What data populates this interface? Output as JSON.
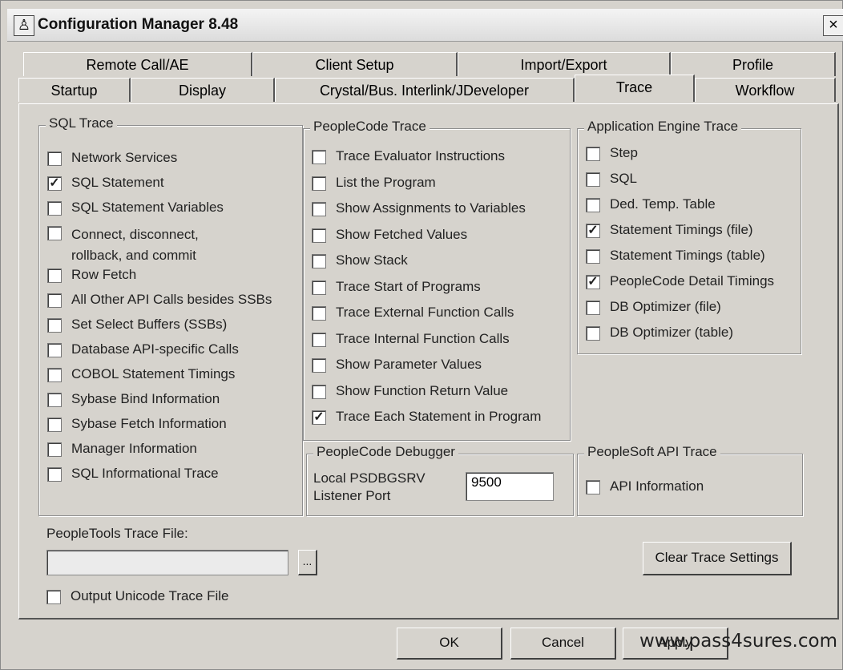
{
  "window": {
    "title": "Configuration Manager 8.48",
    "close_glyph": "×",
    "icon": "app-icon"
  },
  "tabs_row1": [
    "Remote Call/AE",
    "Client Setup",
    "Import/Export",
    "Profile"
  ],
  "tabs_row2": [
    "Startup",
    "Display",
    "Crystal/Bus. Interlink/JDeveloper",
    "Trace",
    "Workflow"
  ],
  "active_tab": "Trace",
  "sql_trace": {
    "title": "SQL Trace",
    "items": [
      {
        "label": "Network Services",
        "checked": false
      },
      {
        "label": "SQL Statement",
        "checked": true
      },
      {
        "label": "SQL Statement Variables",
        "checked": false
      },
      {
        "label": "Connect, disconnect, rollback, and commit",
        "checked": false
      },
      {
        "label": "Row Fetch",
        "checked": false
      },
      {
        "label": "All Other API Calls besides SSBs",
        "checked": false
      },
      {
        "label": "Set Select Buffers (SSBs)",
        "checked": false
      },
      {
        "label": "Database API-specific Calls",
        "checked": false
      },
      {
        "label": "COBOL Statement Timings",
        "checked": false
      },
      {
        "label": "Sybase Bind Information",
        "checked": false
      },
      {
        "label": "Sybase Fetch Information",
        "checked": false
      },
      {
        "label": "Manager Information",
        "checked": false
      },
      {
        "label": "SQL Informational Trace",
        "checked": false
      }
    ]
  },
  "peoplecode_trace": {
    "title": "PeopleCode Trace",
    "items": [
      {
        "label": "Trace Evaluator Instructions",
        "checked": false
      },
      {
        "label": "List the Program",
        "checked": false
      },
      {
        "label": "Show Assignments to Variables",
        "checked": false
      },
      {
        "label": "Show Fetched Values",
        "checked": false
      },
      {
        "label": "Show Stack",
        "checked": false
      },
      {
        "label": "Trace Start of Programs",
        "checked": false
      },
      {
        "label": "Trace External Function Calls",
        "checked": false
      },
      {
        "label": "Trace Internal Function Calls",
        "checked": false
      },
      {
        "label": "Show Parameter Values",
        "checked": false
      },
      {
        "label": "Show Function Return Value",
        "checked": false
      },
      {
        "label": "Trace Each Statement in Program",
        "checked": true
      }
    ]
  },
  "app_engine_trace": {
    "title": "Application Engine Trace",
    "items": [
      {
        "label": "Step",
        "checked": false
      },
      {
        "label": "SQL",
        "checked": false
      },
      {
        "label": "Ded. Temp. Table",
        "checked": false
      },
      {
        "label": "Statement Timings (file)",
        "checked": true
      },
      {
        "label": "Statement Timings (table)",
        "checked": false
      },
      {
        "label": "PeopleCode Detail Timings",
        "checked": true
      },
      {
        "label": "DB Optimizer (file)",
        "checked": false
      },
      {
        "label": "DB Optimizer (table)",
        "checked": false
      }
    ]
  },
  "debugger": {
    "title": "PeopleCode Debugger",
    "port_label_1": "Local PSDBGSRV",
    "port_label_2": "Listener Port",
    "port_value": "9500"
  },
  "api_trace": {
    "title": "PeopleSoft API Trace",
    "item": {
      "label": "API Information",
      "checked": false
    }
  },
  "trace_file": {
    "label": "PeopleTools Trace File:",
    "value": "",
    "browse_label": "..."
  },
  "unicode": {
    "label": "Output Unicode Trace File",
    "checked": false
  },
  "clear_button": "Clear Trace Settings",
  "buttons": {
    "ok": "OK",
    "cancel": "Cancel",
    "apply": "Apply"
  },
  "watermark": "www.pass4sures.com"
}
